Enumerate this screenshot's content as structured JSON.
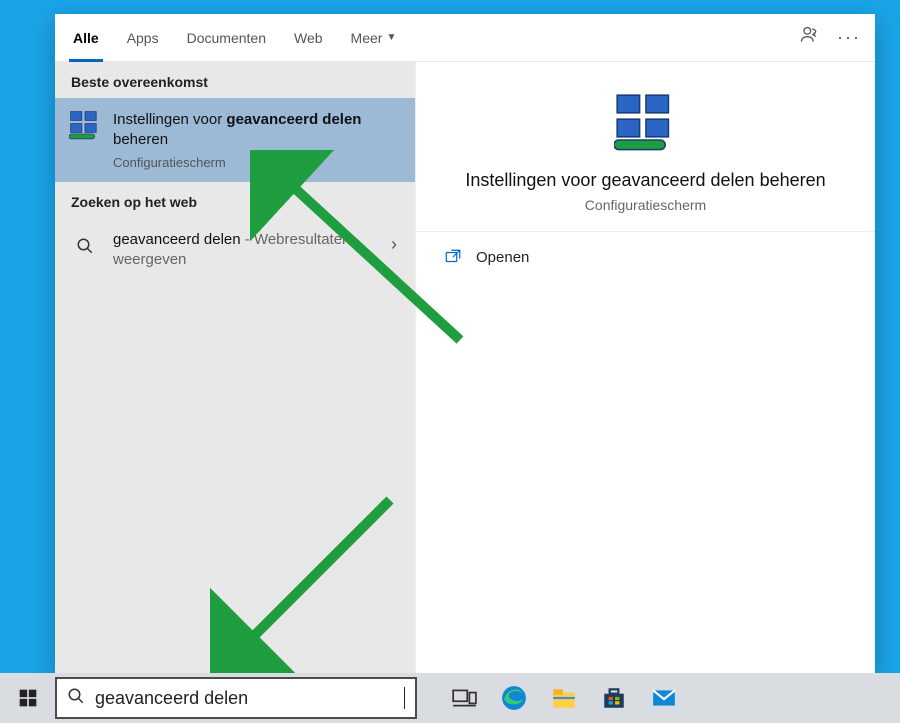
{
  "tabs": {
    "all": "Alle",
    "apps": "Apps",
    "documents": "Documenten",
    "web": "Web",
    "more": "Meer"
  },
  "left": {
    "best_match": "Beste overeenkomst",
    "result_title_pre": "Instellingen voor ",
    "result_title_bold": "geavanceerd delen",
    "result_title_post": " beheren",
    "result_sub": "Configuratiescherm",
    "web_section": "Zoeken op het web",
    "web_result_term": "geavanceerd delen",
    "web_result_tail": " - Webresultaten weergeven"
  },
  "detail": {
    "title": "Instellingen voor geavanceerd delen beheren",
    "sub": "Configuratiescherm",
    "open": "Openen"
  },
  "search_value": "geavanceerd delen"
}
